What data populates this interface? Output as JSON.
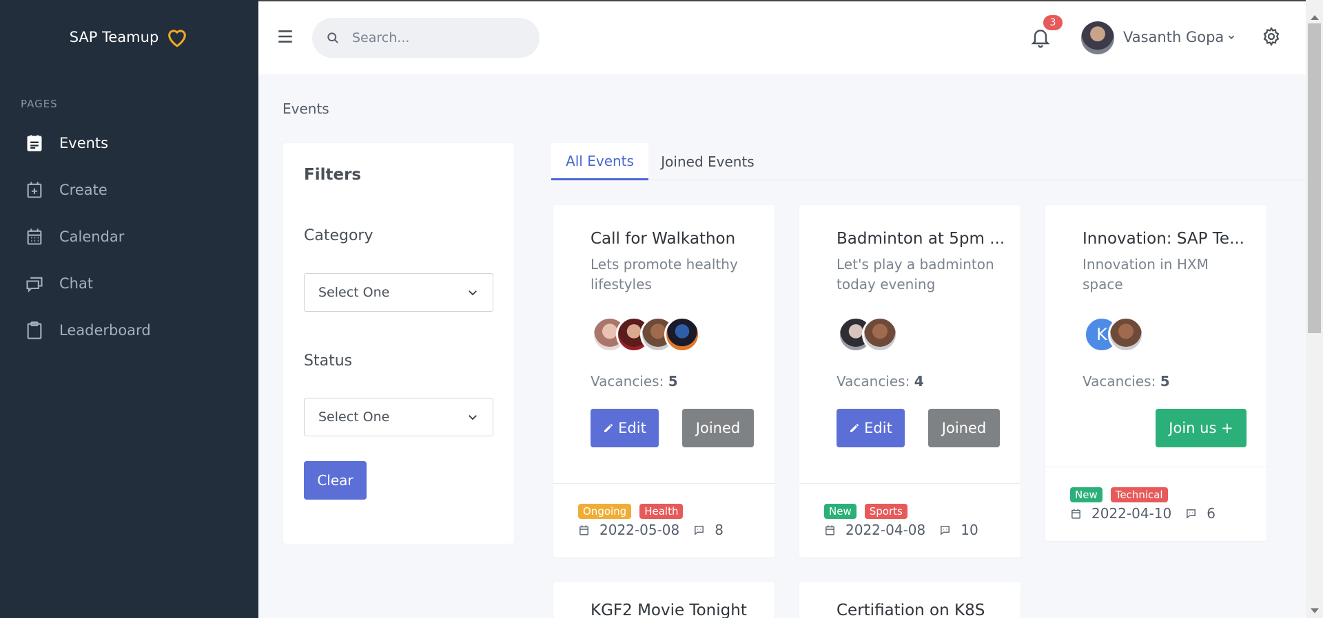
{
  "app": {
    "brand": "SAP Teamup",
    "brand_color": "#f0a822"
  },
  "sidebar": {
    "section": "PAGES",
    "items": [
      {
        "label": "Events",
        "icon": "events-icon",
        "active": true
      },
      {
        "label": "Create",
        "icon": "create-icon",
        "active": false
      },
      {
        "label": "Calendar",
        "icon": "calendar-icon",
        "active": false
      },
      {
        "label": "Chat",
        "icon": "chat-icon",
        "active": false
      },
      {
        "label": "Leaderboard",
        "icon": "clipboard-icon",
        "active": false
      }
    ]
  },
  "header": {
    "search_placeholder": "Search...",
    "notification_count": "3",
    "user_name": "Vasanth Gopa"
  },
  "breadcrumb": "Events",
  "filters": {
    "title": "Filters",
    "category_label": "Category",
    "category_value": "Select One",
    "status_label": "Status",
    "status_value": "Select One",
    "clear_label": "Clear"
  },
  "tabs": [
    {
      "label": "All Events",
      "active": true
    },
    {
      "label": "Joined Events",
      "active": false
    }
  ],
  "cards": [
    {
      "title": "Call for Walkathon",
      "desc": "Lets promote healthy lifestyles",
      "vacancies_label": "Vacancies:",
      "vacancies": "5",
      "edit_label": "Edit",
      "joined_label": "Joined",
      "tags": [
        {
          "text": "Ongoing",
          "color": "#f0ad36"
        },
        {
          "text": "Health",
          "color": "#e65a5a"
        }
      ],
      "date": "2022-05-08",
      "comments": "8"
    },
    {
      "title": "Badminton at 5pm ...",
      "desc": "Let's play a badminton today evening",
      "vacancies_label": "Vacancies:",
      "vacancies": "4",
      "edit_label": "Edit",
      "joined_label": "Joined",
      "tags": [
        {
          "text": "New",
          "color": "#2cb07a"
        },
        {
          "text": "Sports",
          "color": "#e65a5a"
        }
      ],
      "date": "2022-04-08",
      "comments": "10"
    },
    {
      "title": "Innovation: SAP Te...",
      "desc": "Innovation in HXM space",
      "vacancies_label": "Vacancies:",
      "vacancies": "5",
      "join_label": "Join us +",
      "avatar_letter": "K",
      "tags": [
        {
          "text": "New",
          "color": "#2cb07a"
        },
        {
          "text": "Technical",
          "color": "#e65a5a"
        }
      ],
      "date": "2022-04-10",
      "comments": "6"
    },
    {
      "title": "KGF2 Movie Tonight"
    },
    {
      "title": "Certifiation on K8S"
    }
  ]
}
